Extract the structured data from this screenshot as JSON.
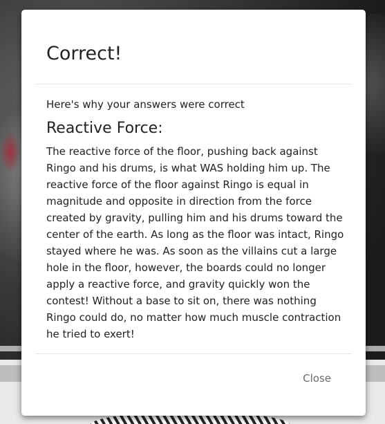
{
  "modal": {
    "title": "Correct!",
    "intro": "Here's why your answers were correct",
    "section_heading": "Reactive Force:",
    "explanation": "The reactive force of the floor, pushing back against Ringo and his drums, is what WAS holding him up. The reactive force of the floor against Ringo is equal in magnitude and opposite in direction from the force created by gravity, pulling him and his drums toward the center of the earth. As long as the floor was intact, Ringo stayed where he was. As soon as the villains cut a large hole in the floor, however, the boards could no longer apply a reactive force, and gravity quickly won the contest! Without a base to sit on, there was nothing Ringo could do, no matter how much muscle contraction he tried to exert!",
    "close_label": "Close"
  }
}
